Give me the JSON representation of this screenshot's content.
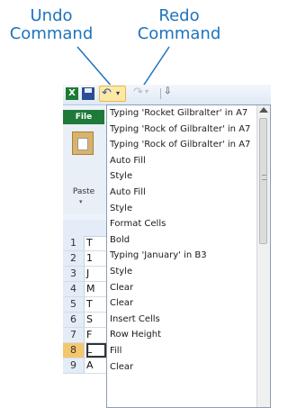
{
  "callouts": {
    "undo": [
      "Undo",
      "Command"
    ],
    "redo": [
      "Redo",
      "Command"
    ]
  },
  "colors": {
    "callout": "#1e73be",
    "file_tab": "#1f7a3a",
    "undo_highlight": "#fde8a6",
    "selected_row": "#f5c76d"
  },
  "qat": {
    "excel_icon": "X",
    "save_icon": "save-icon",
    "undo_icon": "↶",
    "redo_icon": "↷",
    "dropdown_arrow": "▾",
    "customize": "⇩"
  },
  "ribbon": {
    "file_tab": "File",
    "paste_label": "Paste",
    "paste_arrow": "▾"
  },
  "grid": {
    "rows": [
      {
        "num": "1",
        "cell": "T"
      },
      {
        "num": "2",
        "cell": "1"
      },
      {
        "num": "3",
        "cell": "J"
      },
      {
        "num": "4",
        "cell": "M"
      },
      {
        "num": "5",
        "cell": "T"
      },
      {
        "num": "6",
        "cell": "S"
      },
      {
        "num": "7",
        "cell": "F"
      },
      {
        "num": "8",
        "cell": "L"
      },
      {
        "num": "9",
        "cell": "A"
      }
    ]
  },
  "undo_list": {
    "items": [
      "Typing 'Rocket Gilbralter' in A7",
      "Typing 'Rock of Gilbralter' in A7",
      "Typing 'Rock of Gilbralter' in A7",
      "Auto Fill",
      "Style",
      "Auto Fill",
      "Style",
      "Format Cells",
      "Bold",
      "Typing 'January' in B3",
      "Style",
      "Clear",
      "Clear",
      "Insert Cells",
      "Row Height",
      "Fill",
      "Clear"
    ]
  }
}
